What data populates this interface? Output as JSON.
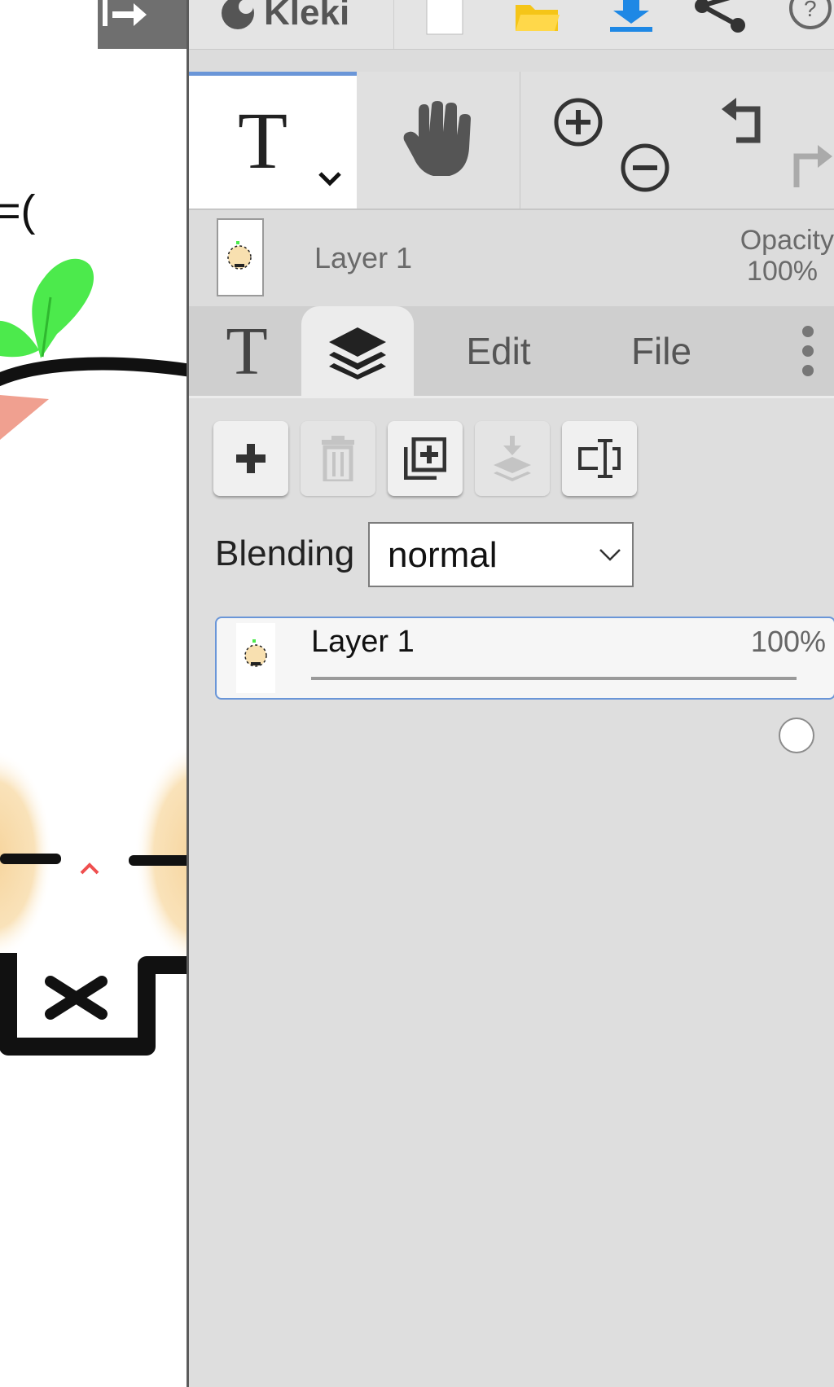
{
  "app": {
    "name": "Kleki"
  },
  "canvas": {
    "visible_text": "=("
  },
  "toolbar": {
    "icons": [
      "hide-ui-icon",
      "kleki-logo-icon",
      "new-canvas-icon",
      "open-folder-icon",
      "download-icon",
      "share-icon",
      "help-icon"
    ]
  },
  "tools": {
    "active_tool": "text-tool",
    "icons": [
      "text-tool-icon",
      "hand-tool-icon",
      "zoom-in-icon",
      "zoom-out-icon",
      "undo-icon",
      "redo-icon"
    ]
  },
  "layer_preview": {
    "name": "Layer 1",
    "opacity_label": "Opacity",
    "opacity_value": "100%"
  },
  "tabs": [
    {
      "id": "brush",
      "label": "T",
      "icon": "text-tool-tab-icon"
    },
    {
      "id": "layers",
      "label": "",
      "icon": "layers-icon",
      "active": true
    },
    {
      "id": "edit",
      "label": "Edit"
    },
    {
      "id": "file",
      "label": "File"
    },
    {
      "id": "more",
      "label": "",
      "icon": "more-vertical-icon"
    }
  ],
  "layer_buttons": [
    {
      "name": "add-layer",
      "icon": "plus-icon",
      "enabled": true
    },
    {
      "name": "delete-layer",
      "icon": "trash-icon",
      "enabled": false
    },
    {
      "name": "duplicate-layer",
      "icon": "duplicate-icon",
      "enabled": true
    },
    {
      "name": "merge-down",
      "icon": "merge-down-icon",
      "enabled": false
    },
    {
      "name": "rename-layer",
      "icon": "rename-icon",
      "enabled": true
    }
  ],
  "blending": {
    "label": "Blending",
    "value": "normal"
  },
  "layers": [
    {
      "name": "Layer 1",
      "opacity_text": "100%",
      "opacity": 1.0,
      "selected": true
    }
  ],
  "colors": {
    "accent": "#6a96d8",
    "panel_bg": "#dcdcdc",
    "download_blue": "#1e88e5",
    "folder_yellow": "#f5c518",
    "leaf_green": "#4cea4c"
  }
}
